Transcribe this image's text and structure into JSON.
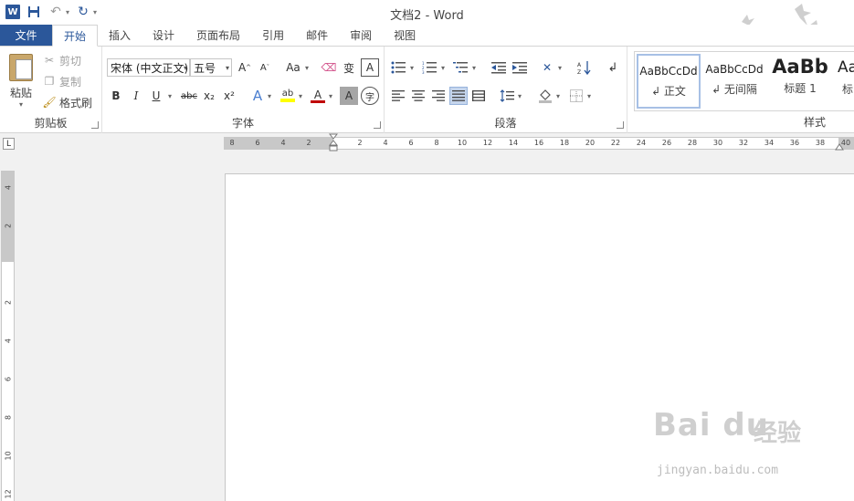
{
  "window": {
    "title": "文档2 - Word"
  },
  "qat": {
    "logo_letter": "W"
  },
  "tabs": [
    {
      "label": "文件"
    },
    {
      "label": "开始"
    },
    {
      "label": "插入"
    },
    {
      "label": "设计"
    },
    {
      "label": "页面布局"
    },
    {
      "label": "引用"
    },
    {
      "label": "邮件"
    },
    {
      "label": "审阅"
    },
    {
      "label": "视图"
    }
  ],
  "clipboard": {
    "paste_label": "粘贴",
    "cut_label": "剪切",
    "copy_label": "复制",
    "format_painter_label": "格式刷",
    "group_label": "剪贴板"
  },
  "font": {
    "font_name": "宋体 (中文正文)",
    "font_size": "五号",
    "group_label": "字体",
    "bold": "B",
    "italic": "I",
    "underline": "U",
    "strikethrough": "abc",
    "subscript": "x₂",
    "superscript": "x²",
    "grow": "A",
    "shrink": "A",
    "change_case": "Aa",
    "phonetic": "变",
    "border_char": "A",
    "text_effect": "A",
    "highlight": "ab",
    "font_color": "A",
    "shading": "A",
    "enclose": "字"
  },
  "paragraph": {
    "group_label": "段落"
  },
  "styles": {
    "group_label": "样式",
    "items": [
      {
        "sample": "AaBbCcDd",
        "name": "↲ 正文"
      },
      {
        "sample": "AaBbCcDd",
        "name": "↲ 无间隔"
      },
      {
        "sample": "AaBb",
        "name": "标题 1"
      },
      {
        "sample": "Aa",
        "name": "标"
      }
    ]
  },
  "ruler": {
    "h_ticks": [
      "8",
      "6",
      "4",
      "2",
      "2",
      "4",
      "6",
      "8",
      "10",
      "12",
      "14",
      "16",
      "18",
      "20",
      "22",
      "24",
      "26",
      "28",
      "30",
      "32",
      "34",
      "36",
      "38",
      "40"
    ],
    "v_ticks": [
      "4",
      "2",
      "2",
      "4",
      "6",
      "8",
      "10",
      "12"
    ],
    "corner": "L"
  },
  "watermark": {
    "brand": "Bai du",
    "cn": "经验",
    "url": "jingyan.baidu.com"
  },
  "colors": {
    "accent": "#2b579a",
    "highlight": "#ffff00",
    "font_color": "#c00000"
  }
}
